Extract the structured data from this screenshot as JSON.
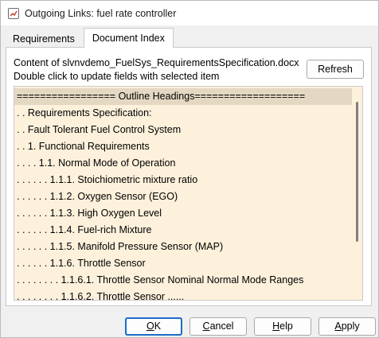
{
  "window": {
    "title": "Outgoing Links: fuel rate controller"
  },
  "tabs": [
    {
      "label": "Requirements",
      "active": false
    },
    {
      "label": "Document Index",
      "active": true
    }
  ],
  "content": {
    "line1": "Content of slvnvdemo_FuelSys_RequirementsSpecification.docx",
    "line2": "Double click to update fields with selected item",
    "refresh_label": "Refresh"
  },
  "outline": {
    "items": [
      "================= Outline Headings===================",
      ". . Requirements Specification:",
      ". . Fault Tolerant Fuel Control System",
      ". . 1. Functional Requirements",
      ". . . . 1.1. Normal Mode of Operation",
      ". . . . . . 1.1.1. Stoichiometric mixture ratio",
      ". . . . . . 1.1.2. Oxygen Sensor (EGO)",
      ". . . . . . 1.1.3. High Oxygen Level",
      ". . . . . . 1.1.4. Fuel-rich Mixture",
      ". . . . . . 1.1.5. Manifold Pressure Sensor (MAP)",
      ". . . . . . 1.1.6. Throttle Sensor",
      ". . . . . . . . 1.1.6.1. Throttle Sensor Nominal Normal Mode Ranges",
      ". . . . . . . . 1.1.6.2. Throttle Sensor ......"
    ],
    "selected_index": 0
  },
  "buttons": {
    "ok_mnemonic": "O",
    "ok_rest": "K",
    "cancel_mnemonic": "C",
    "cancel_rest": "ancel",
    "help_mnemonic": "H",
    "help_rest": "elp",
    "apply_mnemonic": "A",
    "apply_rest": "pply"
  }
}
